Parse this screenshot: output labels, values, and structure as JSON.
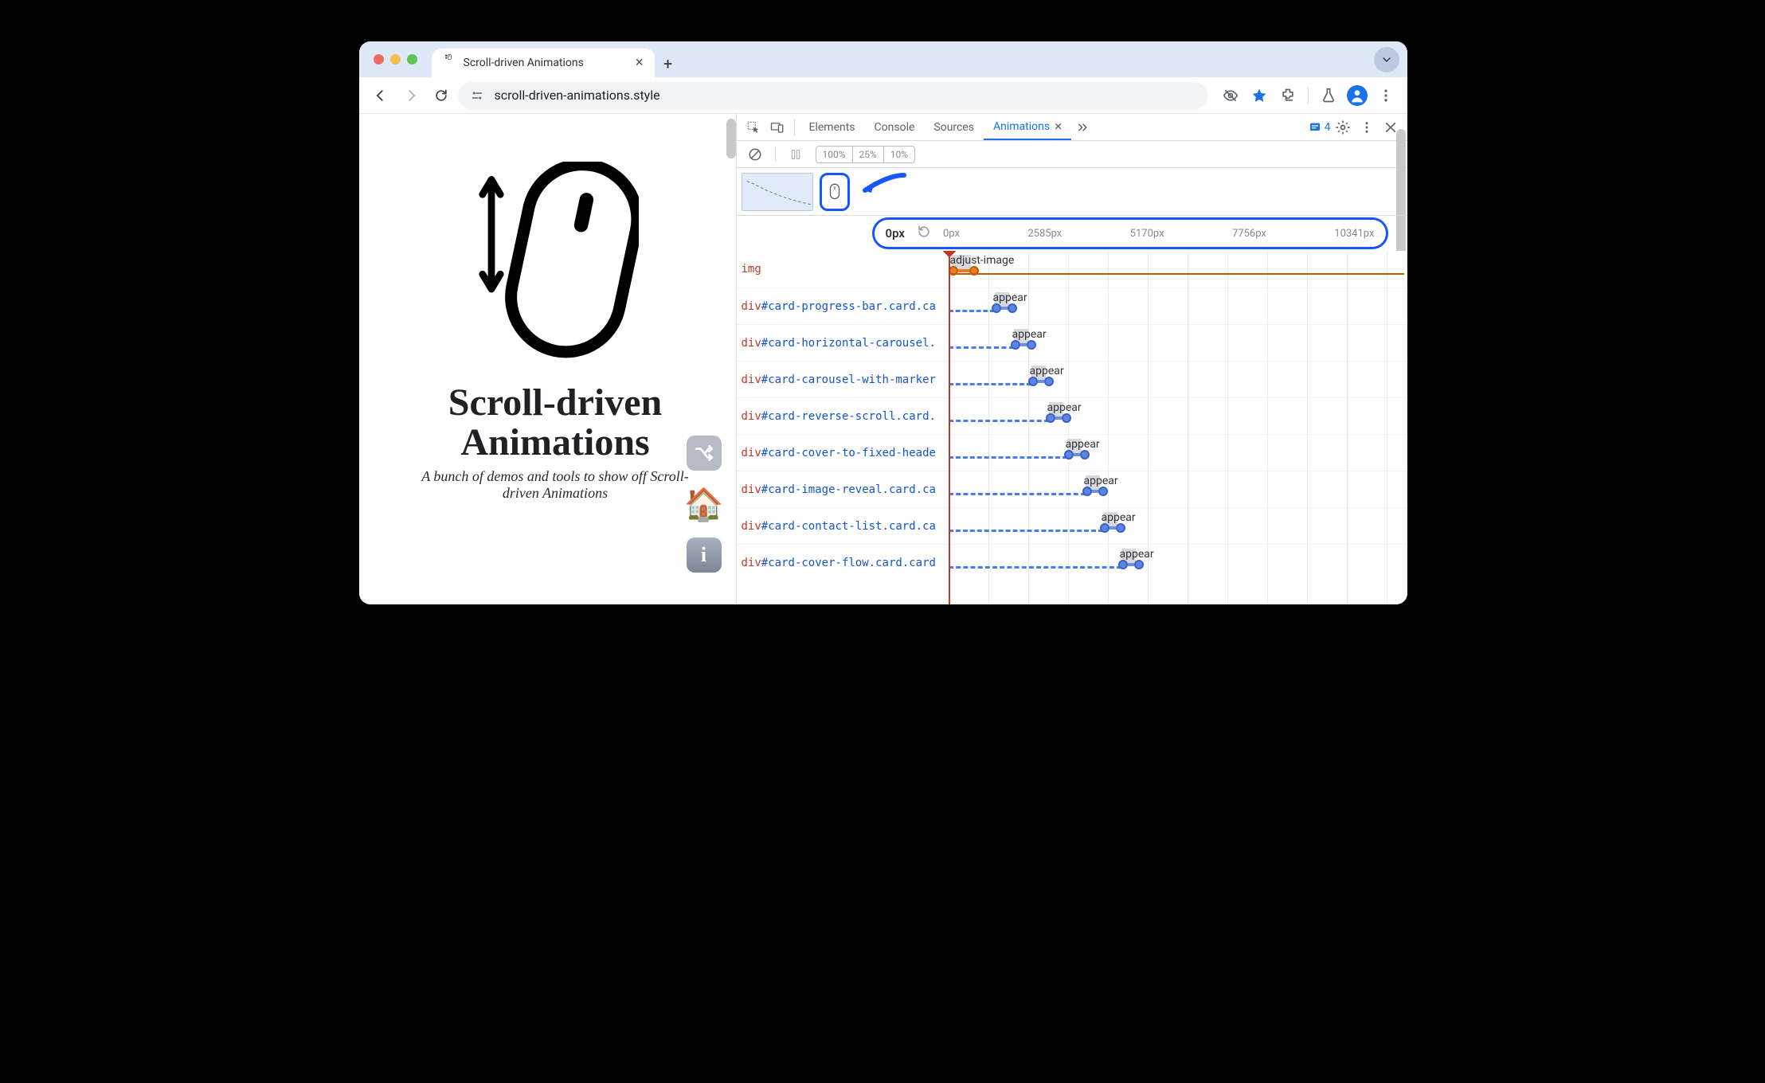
{
  "browser": {
    "tab_title": "Scroll-driven Animations",
    "url": "scroll-driven-animations.style"
  },
  "page": {
    "heading_l1": "Scroll-driven",
    "heading_l2": "Animations",
    "subtitle": "A bunch of demos and tools to show off Scroll-driven Animations"
  },
  "devtools": {
    "tabs": [
      "Elements",
      "Console",
      "Sources",
      "Animations"
    ],
    "active_tab": "Animations",
    "issues_count": "4",
    "speed_options": [
      "100%",
      "25%",
      "10%"
    ],
    "scrubber": {
      "current": "0px",
      "ticks": [
        "0px",
        "2585px",
        "5170px",
        "7756px",
        "10341px"
      ]
    },
    "rows": [
      {
        "tag": "img",
        "idcls": "",
        "anim": "adjust-image",
        "offset": 0,
        "seglen": 30,
        "style": "orange",
        "chipw": 24,
        "dashlen": 999
      },
      {
        "tag": "div",
        "idcls": "#card-progress-bar.card.ca",
        "anim": "appear",
        "offset": 54,
        "seglen": 24,
        "dashlen": 58
      },
      {
        "tag": "div",
        "idcls": "#card-horizontal-carousel.",
        "anim": "appear",
        "offset": 78,
        "seglen": 24,
        "dashlen": 82
      },
      {
        "tag": "div",
        "idcls": "#card-carousel-with-marker",
        "anim": "appear",
        "offset": 100,
        "seglen": 24,
        "dashlen": 104
      },
      {
        "tag": "div",
        "idcls": "#card-reverse-scroll.card.",
        "anim": "appear",
        "offset": 122,
        "seglen": 24,
        "dashlen": 126
      },
      {
        "tag": "div",
        "idcls": "#card-cover-to-fixed-heade",
        "anim": "appear",
        "offset": 145,
        "seglen": 24,
        "dashlen": 149
      },
      {
        "tag": "div",
        "idcls": "#card-image-reveal.card.ca",
        "anim": "appear",
        "offset": 168,
        "seglen": 24,
        "dashlen": 172
      },
      {
        "tag": "div",
        "idcls": "#card-contact-list.card.ca",
        "anim": "appear",
        "offset": 190,
        "seglen": 24,
        "dashlen": 194
      },
      {
        "tag": "div",
        "idcls": "#card-cover-flow.card.card",
        "anim": "appear",
        "offset": 213,
        "seglen": 24,
        "dashlen": 217
      }
    ]
  }
}
